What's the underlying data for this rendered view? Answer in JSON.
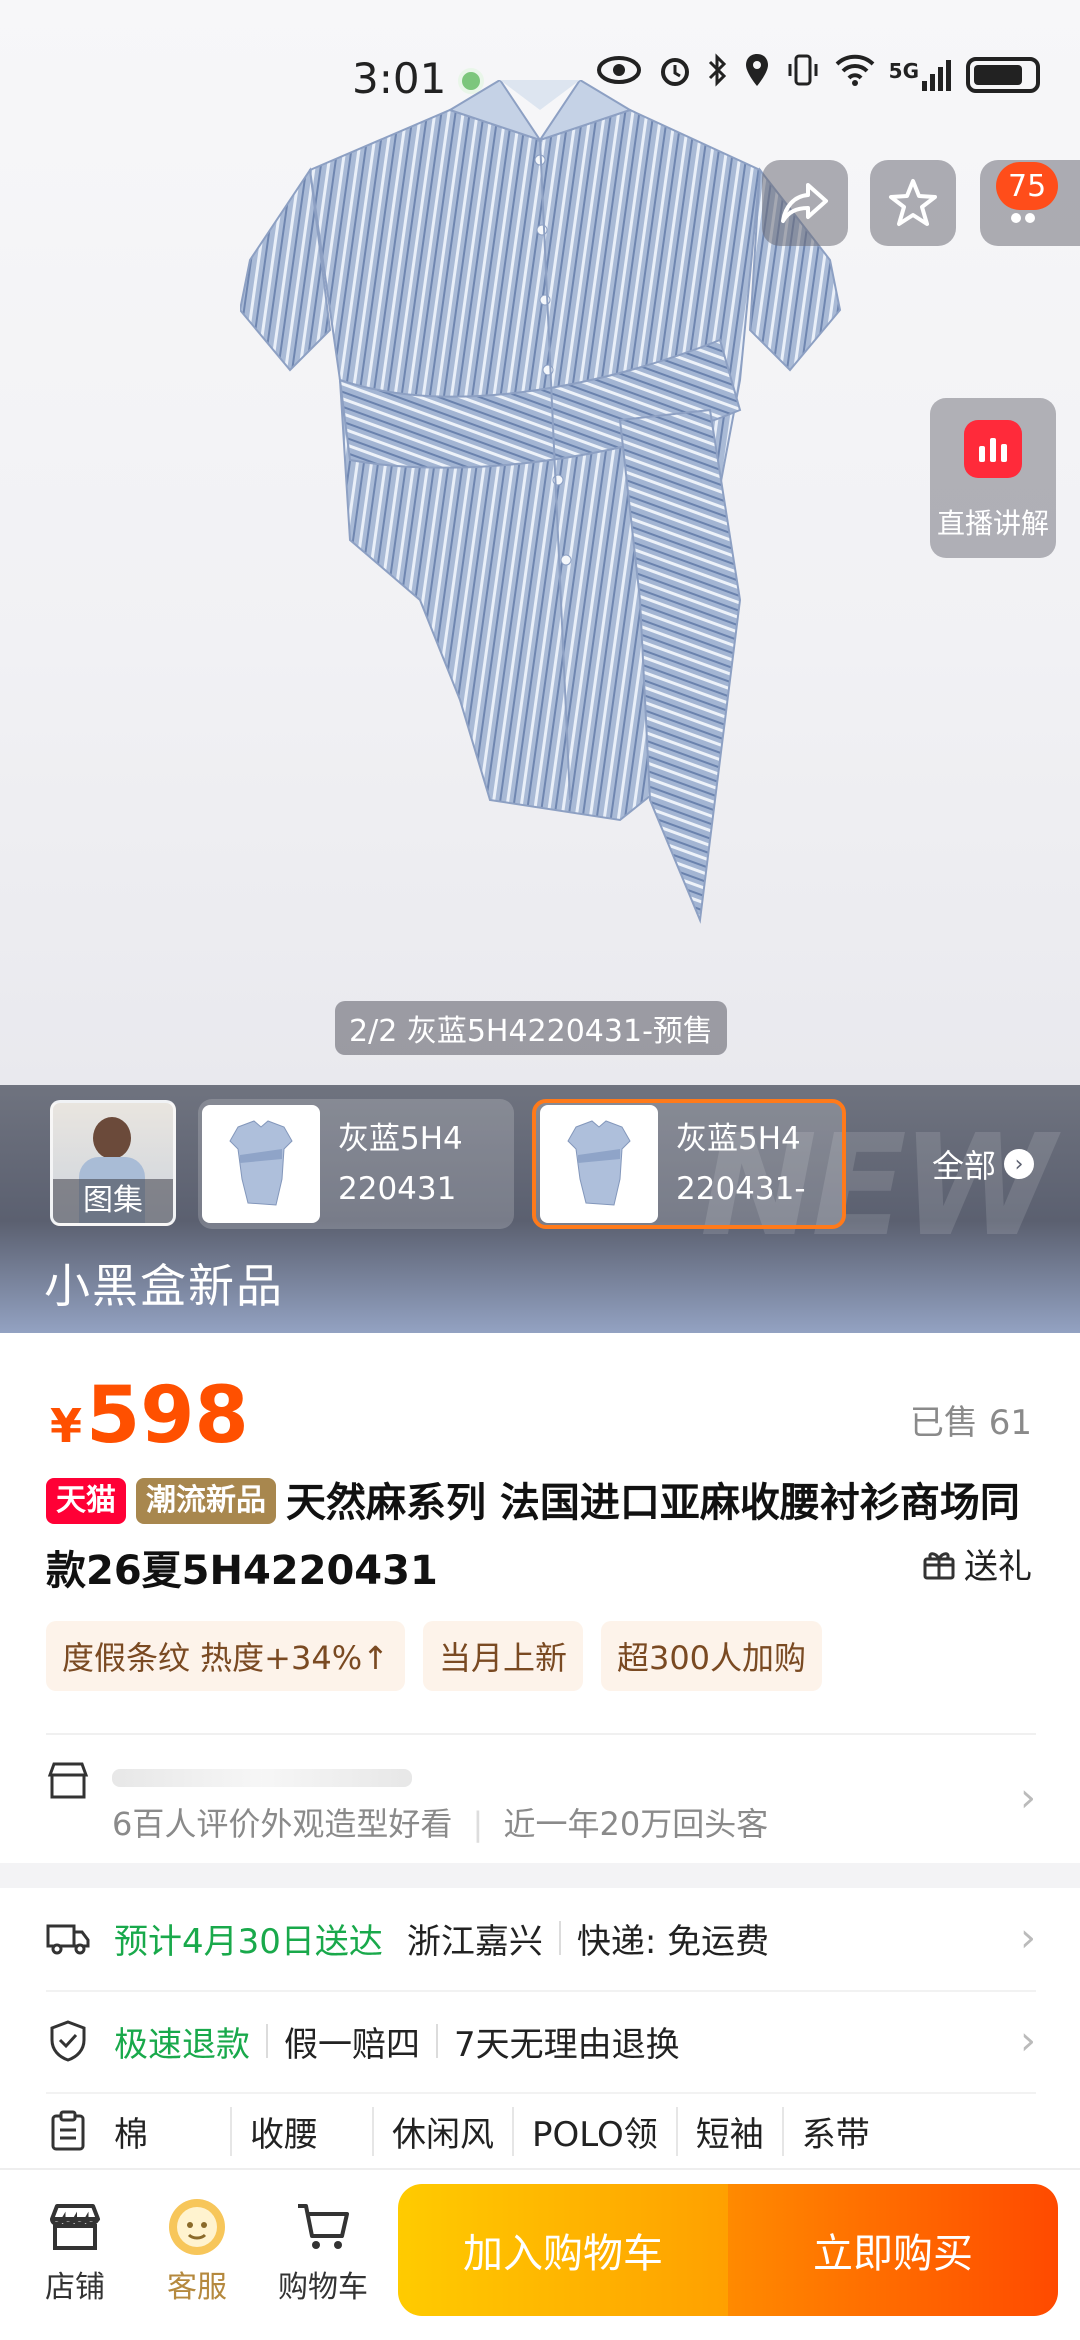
{
  "status_bar": {
    "time": "3:01",
    "network": "5G"
  },
  "hero": {
    "image_indicator": "2/2 灰蓝5H4220431-预售",
    "more_badge": "75",
    "live_label": "直播讲解"
  },
  "variants": {
    "gallery_label": "图集",
    "items": [
      {
        "label": "灰蓝5H4\n220431"
      },
      {
        "label": "灰蓝5H4\n220431-"
      }
    ],
    "all_label": "全部",
    "strip_title": "小黑盒新品"
  },
  "product": {
    "currency": "¥",
    "price": "598",
    "sold": "已售 61",
    "tag_tmall": "天猫",
    "tag_new": "潮流新品",
    "title": "天然麻系列        法国进口亚麻收腰衬衫商场同款26夏5H4220431",
    "gift_label": "送礼",
    "chips": [
      "度假条纹 热度+34%↑",
      "当月上新",
      "超300人加购"
    ]
  },
  "shop": {
    "subtitle_1": "6百人评价外观造型好看",
    "subtitle_2": "近一年20万回头客"
  },
  "service": {
    "delivery": "预计4月30日送达",
    "origin": "浙江嘉兴",
    "shipping": "快递: 免运费",
    "refund": "极速退款",
    "guarantee_1": "假一赔四",
    "guarantee_2": "7天无理由退换",
    "attributes": [
      "棉",
      "收腰",
      "休闲风",
      "POLO领",
      "短袖",
      "系带"
    ]
  },
  "bottom_bar": {
    "shop": "店铺",
    "service": "客服",
    "cart": "购物车",
    "add_to_cart": "加入购物车",
    "buy_now": "立即购买"
  },
  "colors": {
    "price": "#ff5000",
    "tmall": "#ff0036",
    "accent_green": "#19a94b",
    "buy": "#ff4a00",
    "cart": "#ffb000"
  }
}
